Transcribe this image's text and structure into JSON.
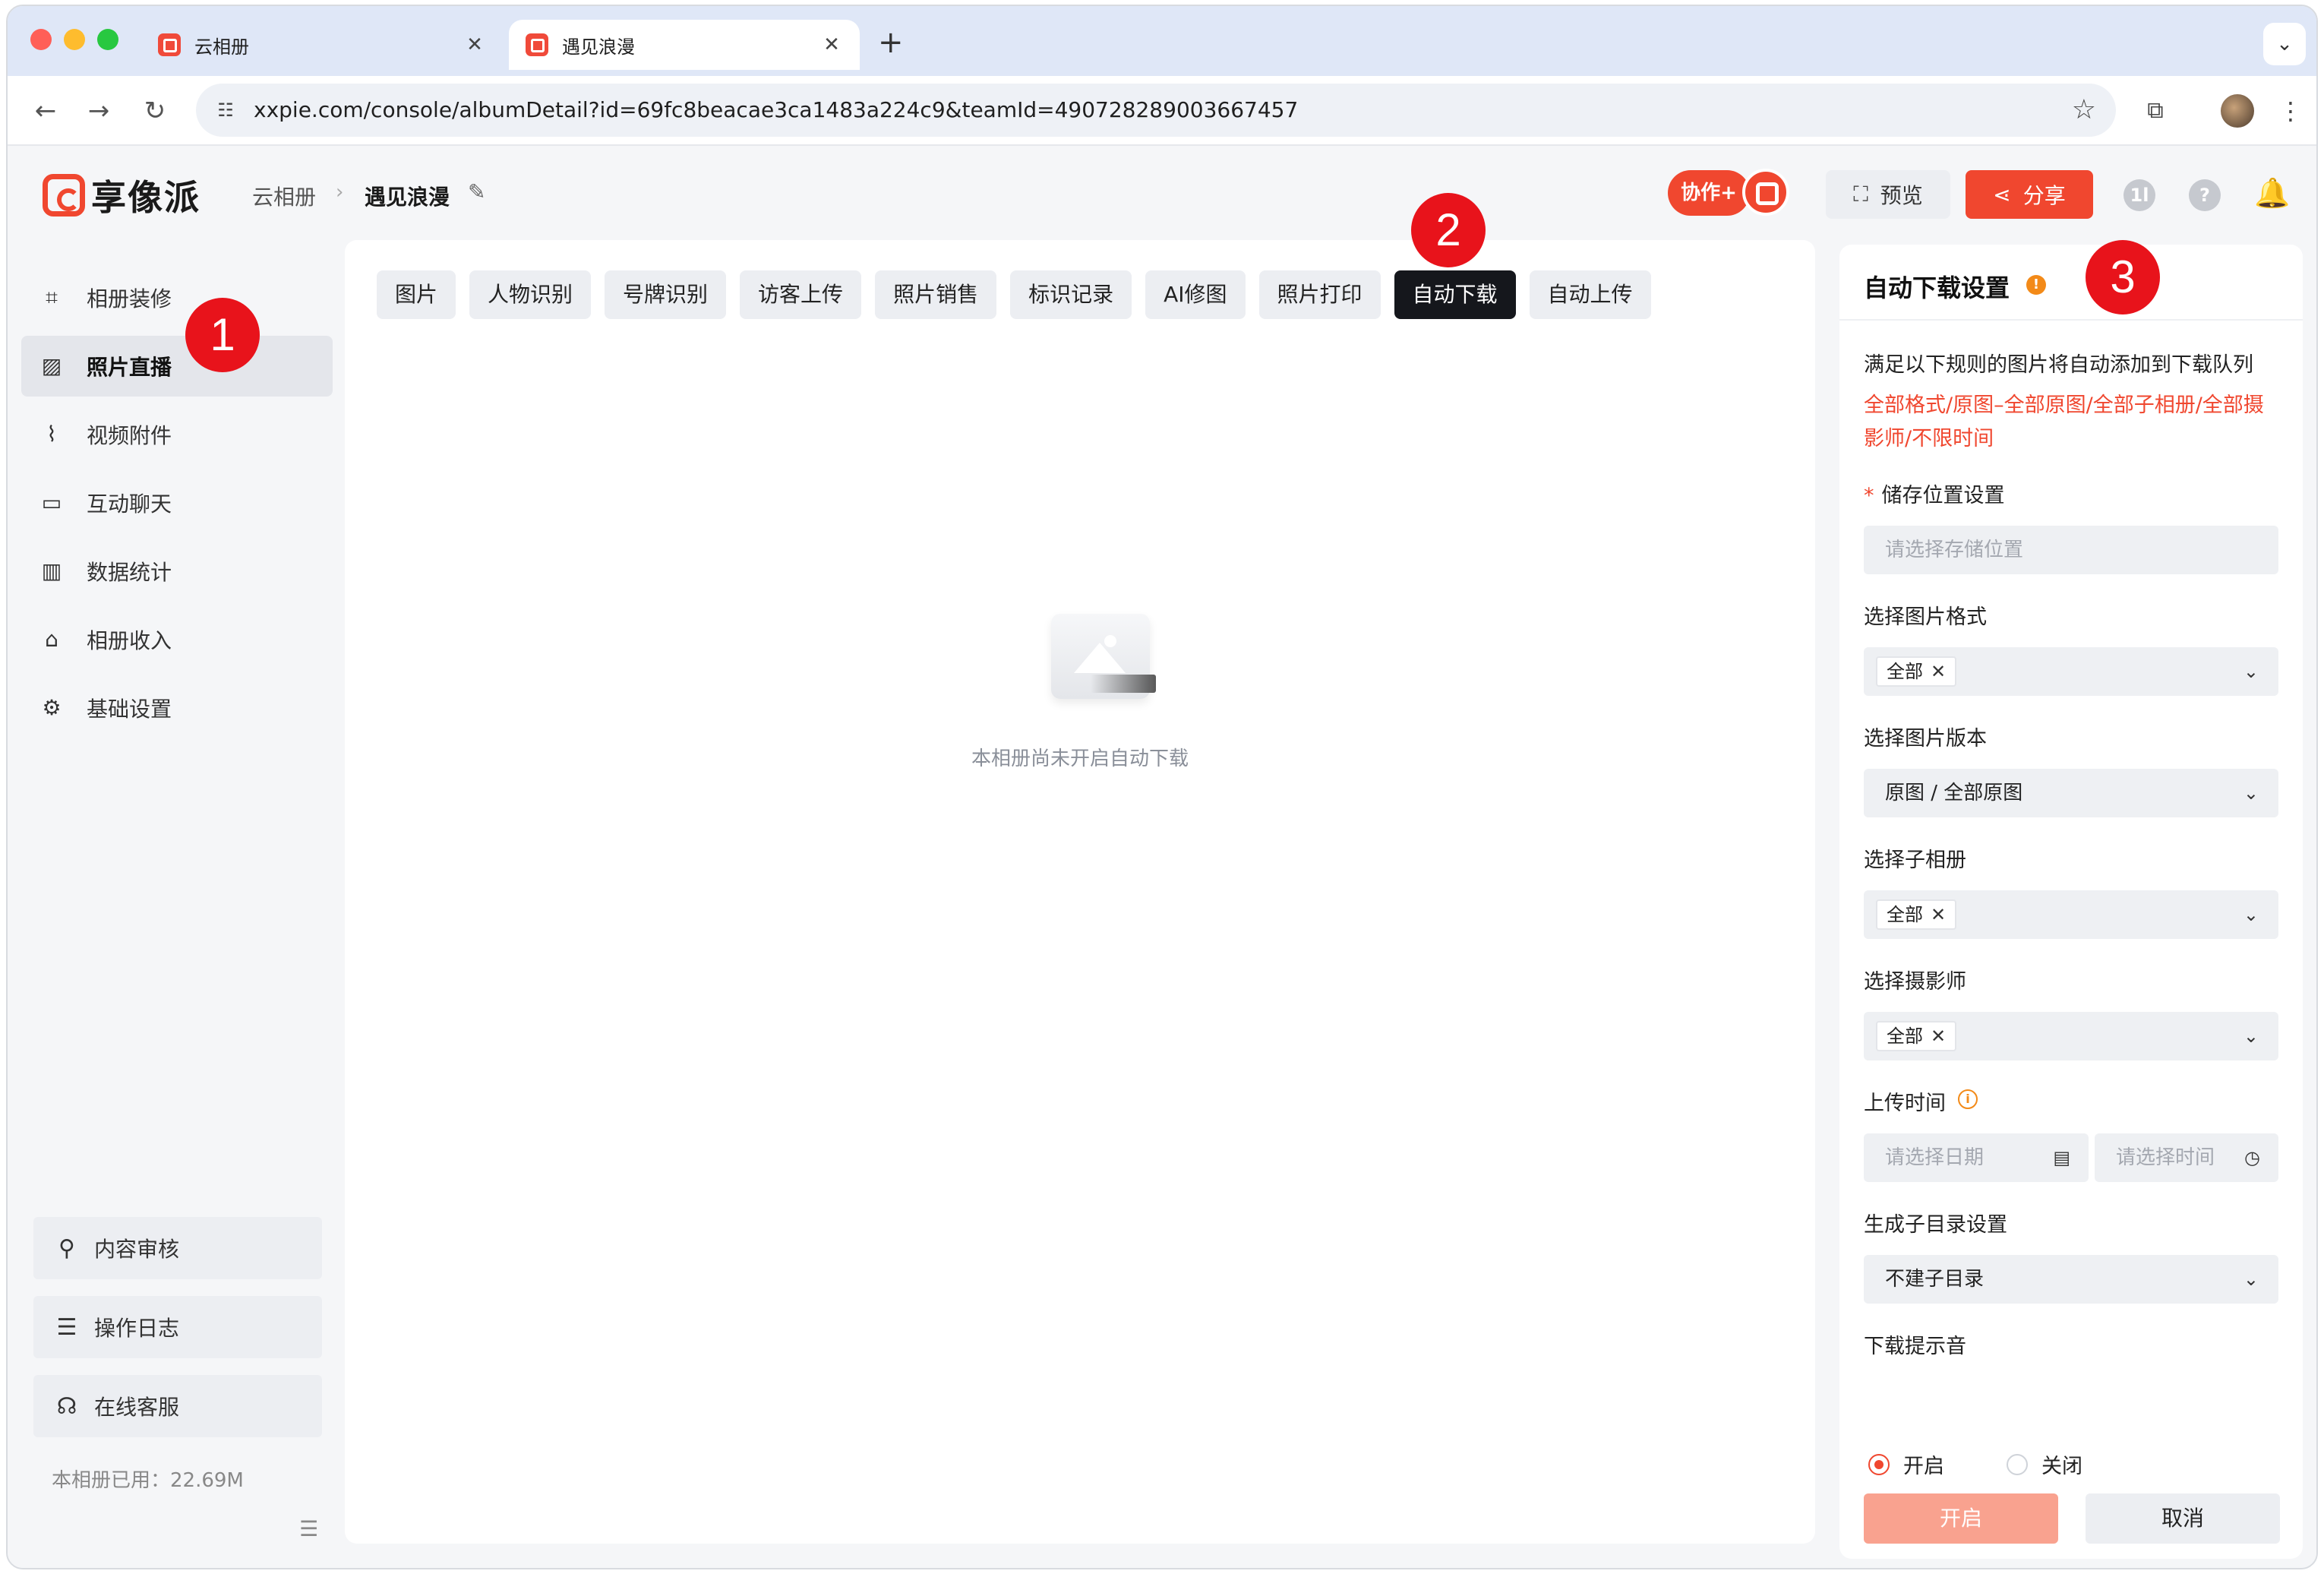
{
  "browser": {
    "tabs": [
      {
        "title": "云相册",
        "close": "✕"
      },
      {
        "title": "遇见浪漫",
        "close": "✕"
      }
    ],
    "new_tab": "+",
    "tab_menu": "⌄",
    "url": "xxpie.com/console/albumDetail?id=69fc8beacae3ca1483a224c9&teamId=490728289003667457",
    "icons": {
      "back": "arrow-left-icon",
      "forward": "arrow-right-icon",
      "reload": "reload-icon",
      "site": "tune-icon",
      "star": "star-icon",
      "extensions": "puzzle-icon",
      "menu": "kebab-icon"
    }
  },
  "header": {
    "logo_text": "享像派",
    "breadcrumb": [
      "云相册",
      "遇见浪漫"
    ],
    "collab_label": "协作+",
    "preview_label": "预览",
    "share_label": "分享",
    "user_badge": "1l",
    "help": "?",
    "accent": "#f0472f"
  },
  "sidebar": {
    "items": [
      {
        "label": "相册装修",
        "icon": "scan-icon"
      },
      {
        "label": "照片直播",
        "icon": "image-icon"
      },
      {
        "label": "视频附件",
        "icon": "paperclip-icon"
      },
      {
        "label": "互动聊天",
        "icon": "chat-icon"
      },
      {
        "label": "数据统计",
        "icon": "chart-icon"
      },
      {
        "label": "相册收入",
        "icon": "store-icon"
      },
      {
        "label": "基础设置",
        "icon": "gear-icon"
      }
    ],
    "bottom_buttons": [
      {
        "label": "内容审核",
        "icon": "stamp-icon"
      },
      {
        "label": "操作日志",
        "icon": "log-icon"
      },
      {
        "label": "在线客服",
        "icon": "headset-icon"
      }
    ],
    "usage": "本相册已用：22.69M"
  },
  "main": {
    "tabs": [
      "图片",
      "人物识别",
      "号牌识别",
      "访客上传",
      "照片销售",
      "标识记录",
      "AI修图",
      "照片打印",
      "自动下载",
      "自动上传"
    ],
    "active_tab": "自动下载",
    "empty_text": "本相册尚未开启自动下载"
  },
  "settings": {
    "title": "自动下载设置",
    "info": "!",
    "rule_desc": "满足以下规则的图片将自动添加到下载队列",
    "rule_summary": "全部格式/原图–全部原图/全部子相册/全部摄影师/不限时间",
    "storage_label": "储存位置设置",
    "storage_required": "*",
    "storage_placeholder": "请选择存储位置",
    "format_label": "选择图片格式",
    "format_chip": "全部",
    "version_label": "选择图片版本",
    "version_value": "原图 / 全部原图",
    "subalbum_label": "选择子相册",
    "subalbum_chip": "全部",
    "photographer_label": "选择摄影师",
    "photographer_chip": "全部",
    "time_label": "上传时间",
    "time_tip": "i",
    "date_placeholder": "请选择日期",
    "time_placeholder": "请选择时间",
    "subdir_label": "生成子目录设置",
    "subdir_value": "不建子目录",
    "sound_label": "下载提示音",
    "sound_on": "开启",
    "sound_off": "关闭",
    "open_button": "开启",
    "cancel_button": "取消"
  },
  "annotations": [
    "1",
    "2",
    "3"
  ]
}
